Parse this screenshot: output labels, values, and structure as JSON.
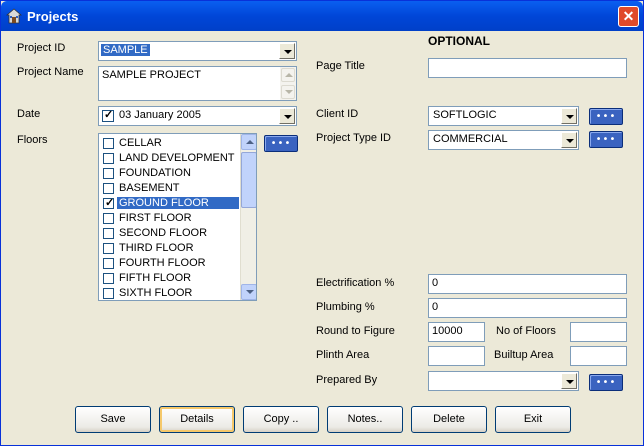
{
  "window": {
    "title": "Projects",
    "close_label": "✕"
  },
  "form": {
    "project_id_label": "Project ID",
    "project_id_value": "SAMPLE",
    "project_name_label": "Project Name",
    "project_name_value": "SAMPLE PROJECT",
    "date_label": "Date",
    "date_value": "03  January  2005",
    "floors_label": "Floors",
    "floors": [
      {
        "label": "CELLAR",
        "checked": false,
        "selected": false
      },
      {
        "label": "LAND DEVELOPMENT",
        "checked": false,
        "selected": false
      },
      {
        "label": "FOUNDATION",
        "checked": false,
        "selected": false
      },
      {
        "label": "BASEMENT",
        "checked": false,
        "selected": false
      },
      {
        "label": "GROUND FLOOR",
        "checked": true,
        "selected": true
      },
      {
        "label": "FIRST FLOOR",
        "checked": false,
        "selected": false
      },
      {
        "label": "SECOND FLOOR",
        "checked": false,
        "selected": false
      },
      {
        "label": "THIRD FLOOR",
        "checked": false,
        "selected": false
      },
      {
        "label": "FOURTH FLOOR",
        "checked": false,
        "selected": false
      },
      {
        "label": "FIFTH FLOOR",
        "checked": false,
        "selected": false
      },
      {
        "label": "SIXTH FLOOR",
        "checked": false,
        "selected": false
      }
    ]
  },
  "optional": {
    "heading": "OPTIONAL",
    "page_title_label": "Page Title",
    "page_title_value": "",
    "client_id_label": "Client ID",
    "client_id_value": "SOFTLOGIC",
    "project_type_label": "Project Type ID",
    "project_type_value": "COMMERCIAL",
    "electrification_label": "Electrification %",
    "electrification_value": "0",
    "plumbing_label": "Plumbing %",
    "plumbing_value": "0",
    "round_label": "Round to Figure",
    "round_value": "10000",
    "no_floors_label": "No of Floors",
    "no_floors_value": "",
    "plinth_label": "Plinth Area",
    "plinth_value": "",
    "builtup_label": "Builtup Area",
    "builtup_value": "",
    "prepared_by_label": "Prepared By",
    "prepared_by_value": ""
  },
  "buttons": {
    "save": "Save",
    "details": "Details",
    "copy": "Copy ..",
    "notes": "Notes..",
    "delete": "Delete",
    "exit": "Exit"
  },
  "colors": {
    "accent": "#316ac5",
    "titlebar": "#0054e3",
    "face": "#ece9d8"
  }
}
